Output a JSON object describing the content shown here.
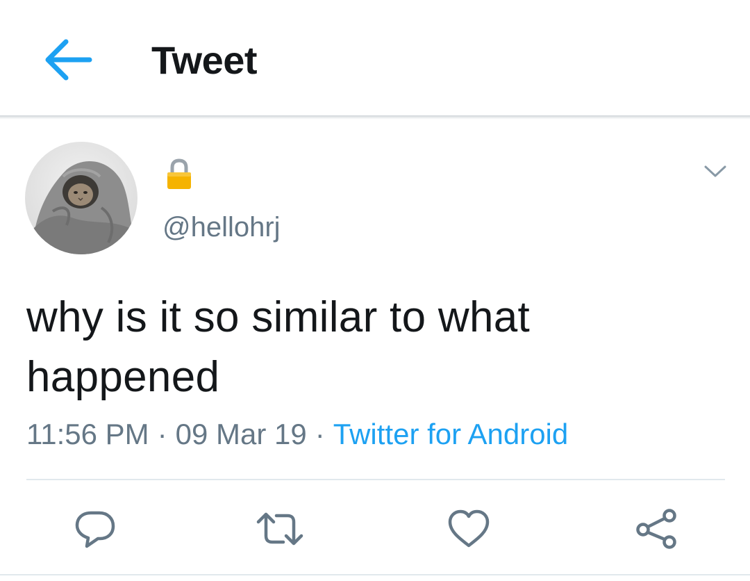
{
  "header": {
    "back_icon": "arrow-left-icon",
    "title": "Tweet"
  },
  "tweet": {
    "avatar_description_icon": "avatar-image",
    "protected_icon": "lock-icon",
    "handle": "@hellohrj",
    "caret_icon": "chevron-down-icon",
    "text": "why is it so similar to what happened",
    "time": "11:56 PM",
    "separator": "·",
    "date": "09 Mar 19",
    "source": "Twitter for Android"
  },
  "actions": [
    {
      "icon": "reply-icon"
    },
    {
      "icon": "retweet-icon"
    },
    {
      "icon": "like-icon"
    },
    {
      "icon": "share-icon"
    }
  ],
  "colors": {
    "accent": "#1da1f2",
    "text_primary": "#14171a",
    "text_secondary": "#657786",
    "icon_gray": "#657786",
    "divider": "#e1e8ed",
    "lock_gold": "#f5b300"
  }
}
